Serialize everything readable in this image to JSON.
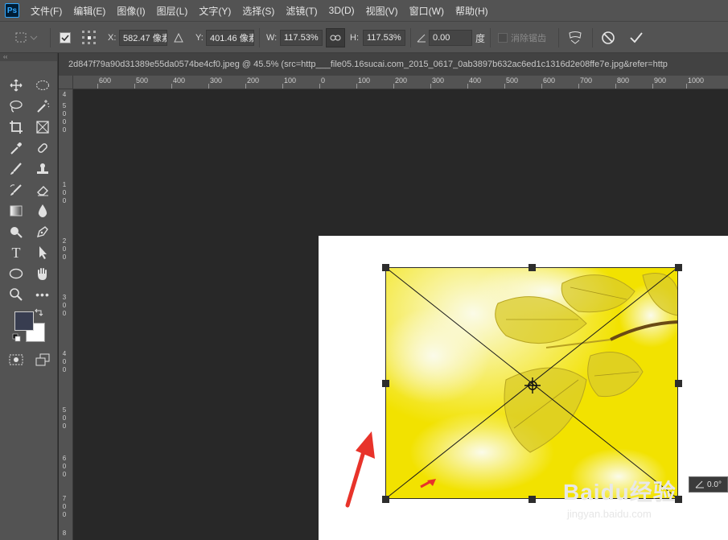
{
  "app": {
    "logo": "Ps"
  },
  "menu": [
    "文件(F)",
    "编辑(E)",
    "图像(I)",
    "图层(L)",
    "文字(Y)",
    "选择(S)",
    "滤镜(T)",
    "3D(D)",
    "视图(V)",
    "窗口(W)",
    "帮助(H)"
  ],
  "options": {
    "x_label": "X:",
    "x_value": "582.47 像素",
    "y_label": "Y:",
    "y_value": "401.46 像素",
    "w_label": "W:",
    "w_value": "117.53%",
    "h_label": "H:",
    "h_value": "117.53%",
    "angle_value": "0.00",
    "angle_unit": "度",
    "antialias_label": "消除锯齿"
  },
  "document": {
    "tab_title": "2d847f79a90d31389e55da0574be4cf0.jpeg @ 45.5% (src=http___file05.16sucai.com_2015_0617_0ab3897b632ac6ed1c1316d2e08ffe7e.jpg&refer=http"
  },
  "ruler_h": [
    "600",
    "500",
    "400",
    "300",
    "200",
    "100",
    "0",
    "100",
    "200",
    "300",
    "400",
    "500",
    "600",
    "700",
    "800",
    "900",
    "1000"
  ],
  "ruler_v": [
    "4",
    "5",
    "0",
    "0",
    "0",
    "1",
    "0",
    "0",
    "2",
    "0",
    "0",
    "3",
    "0",
    "0",
    "4",
    "0",
    "0",
    "5",
    "0",
    "0",
    "6",
    "0",
    "0",
    "7",
    "0",
    "0",
    "8"
  ],
  "angle_badge": "0.0°",
  "watermark": {
    "brand": "Baidu经验",
    "url": "jingyan.baidu.com"
  },
  "colors": {
    "foreground": "#383d50",
    "background": "#ffffff",
    "arrow": "#e8332a"
  }
}
